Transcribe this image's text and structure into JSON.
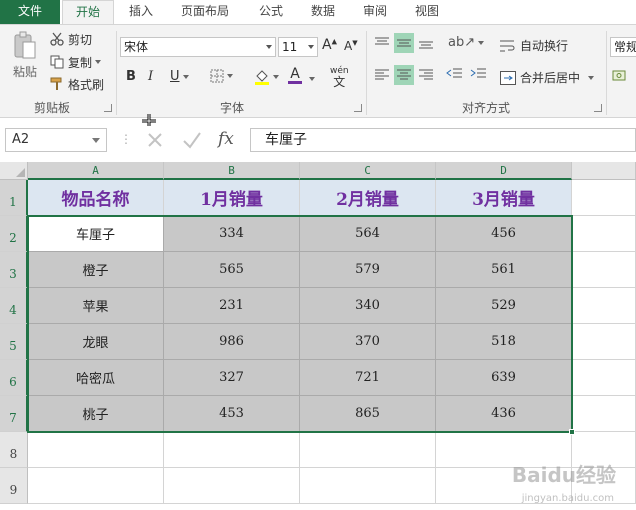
{
  "tabs": [
    "文件",
    "开始",
    "插入",
    "页面布局",
    "公式",
    "数据",
    "审阅",
    "视图"
  ],
  "ribbon": {
    "clipboard": {
      "paste": "粘贴",
      "cut": "剪切",
      "copy": "复制",
      "format_painter": "格式刷",
      "group_label": "剪贴板"
    },
    "font": {
      "font_name": "宋体",
      "font_size": "11",
      "group_label": "字体",
      "wen_label": "wén",
      "wen_char": "文"
    },
    "alignment": {
      "wrap_text": "自动换行",
      "merge_center": "合并后居中",
      "group_label": "对齐方式"
    },
    "number": {
      "format": "常规"
    }
  },
  "formula_bar": {
    "name_box": "A2",
    "fx_label": "fx",
    "value": "车厘子"
  },
  "sheet": {
    "columns": [
      "A",
      "B",
      "C",
      "D"
    ],
    "rows": [
      "1",
      "2",
      "3",
      "4",
      "5",
      "6",
      "7",
      "8",
      "9"
    ],
    "header_row": [
      "物品名称",
      "1月销量",
      "2月销量",
      "3月销量"
    ],
    "data_rows": [
      [
        "车厘子",
        "334",
        "564",
        "456"
      ],
      [
        "橙子",
        "565",
        "579",
        "561"
      ],
      [
        "苹果",
        "231",
        "340",
        "529"
      ],
      [
        "龙眼",
        "986",
        "370",
        "518"
      ],
      [
        "哈密瓜",
        "327",
        "721",
        "639"
      ],
      [
        "桃子",
        "453",
        "865",
        "436"
      ]
    ],
    "header_text_color": "#7030a0",
    "header_fill": "#dce6f1",
    "selection_fill": "#c8c8c8",
    "accent": "#217346"
  },
  "watermark": {
    "main": "Baidu经验",
    "sub": "jingyan.baidu.com"
  }
}
